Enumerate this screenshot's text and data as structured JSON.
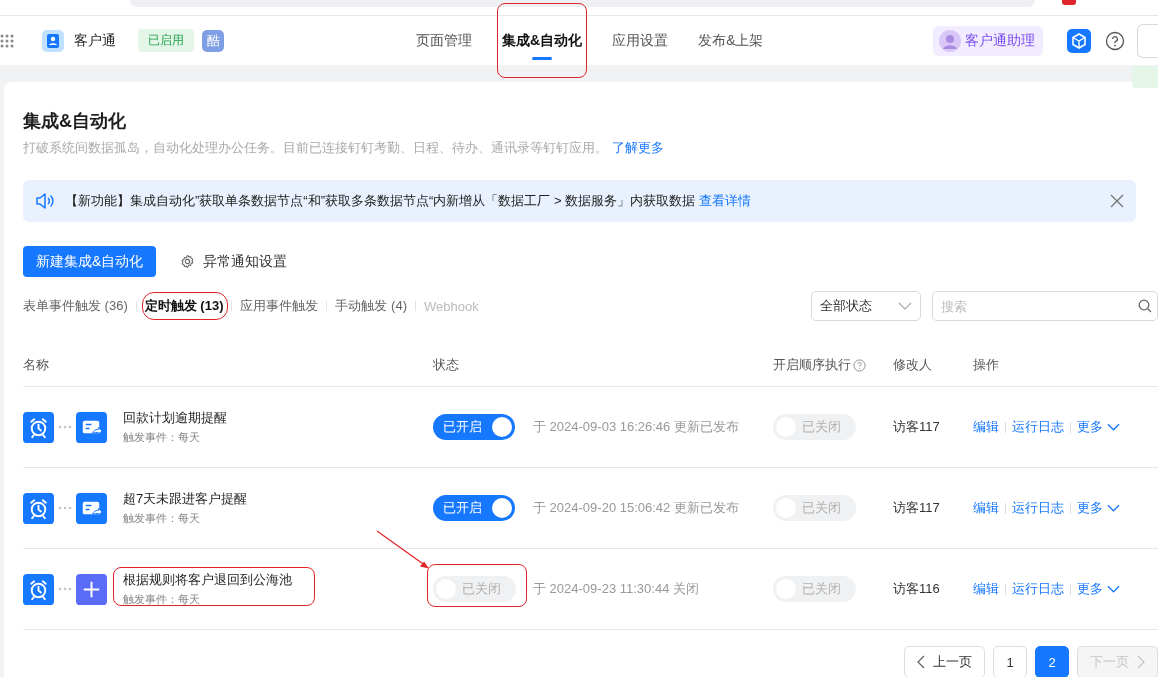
{
  "app": {
    "name": "客户通",
    "status_badge": "已启用",
    "avatar_char": "酷"
  },
  "nav_tabs": [
    {
      "label": "页面管理",
      "selected": false,
      "circled": false
    },
    {
      "label": "集成&自动化",
      "selected": true,
      "circled": true
    },
    {
      "label": "应用设置",
      "selected": false,
      "circled": false
    },
    {
      "label": "发布&上架",
      "selected": false,
      "circled": false
    }
  ],
  "assistant_button": "客户通助理",
  "page": {
    "title": "集成&自动化",
    "description": "打破系统间数据孤岛，自动化处理办公任务。目前已连接钉钉考勤、日程、待办、通讯录等钉钉应用。",
    "learn_more_link": "了解更多"
  },
  "notice": {
    "text": "【新功能】集成自动化”获取单条数据节点“和”获取多条数据节点“内新增从「数据工厂 > 数据服务」内获取数据",
    "link": "查看详情"
  },
  "create_button": "新建集成&自动化",
  "settings_link": "异常通知设置",
  "filter_tabs": [
    {
      "label": "表单事件触发 (36)",
      "selected": false,
      "disabled": false,
      "circled": false
    },
    {
      "label": "定时触发 (13)",
      "selected": true,
      "disabled": false,
      "circled": true
    },
    {
      "label": "应用事件触发",
      "selected": false,
      "disabled": false,
      "circled": false
    },
    {
      "label": "手动触发 (4)",
      "selected": false,
      "disabled": false,
      "circled": false
    },
    {
      "label": "Webhook",
      "selected": false,
      "disabled": true,
      "circled": false
    }
  ],
  "status_filter": "全部状态",
  "search": {
    "placeholder": "搜索"
  },
  "table": {
    "columns": [
      {
        "label": "名称",
        "help": false
      },
      {
        "label": "状态",
        "help": false
      },
      {
        "label": "开启顺序执行",
        "help": true
      },
      {
        "label": "修改人",
        "help": false
      },
      {
        "label": "操作",
        "help": false
      }
    ],
    "rows": [
      {
        "name": "回款计划逾期提醒",
        "trigger": "触发事件：每天",
        "action_icon": {
          "kind": "card"
        },
        "status": {
          "on": true,
          "label": "已开启"
        },
        "update_note": "于 2024-09-03 16:26:46 更新已发布",
        "sequential": {
          "on": false,
          "label": "已关闭"
        },
        "modifier": "访客117",
        "actions": [
          "编辑",
          "运行日志",
          "更多"
        ],
        "name_circled": false,
        "status_circled": false
      },
      {
        "name": "超7天未跟进客户提醒",
        "trigger": "触发事件：每天",
        "action_icon": {
          "kind": "card"
        },
        "status": {
          "on": true,
          "label": "已开启"
        },
        "update_note": "于 2024-09-20 15:06:42 更新已发布",
        "sequential": {
          "on": false,
          "label": "已关闭"
        },
        "modifier": "访客117",
        "actions": [
          "编辑",
          "运行日志",
          "更多"
        ],
        "name_circled": false,
        "status_circled": false
      },
      {
        "name": "根据规则将客户退回到公海池",
        "trigger": "触发事件：每天",
        "action_icon": {
          "kind": "add"
        },
        "status": {
          "on": false,
          "label": "已关闭"
        },
        "update_note": "于 2024-09-23 11:30:44 关闭",
        "sequential": {
          "on": false,
          "label": "已关闭"
        },
        "modifier": "访客116",
        "actions": [
          "编辑",
          "运行日志",
          "更多"
        ],
        "name_circled": true,
        "status_circled": true
      }
    ]
  },
  "pagination": {
    "prev": "上一页",
    "pages": [
      {
        "label": "1",
        "selected": false
      },
      {
        "label": "2",
        "selected": true
      }
    ],
    "next": "下一页",
    "next_disabled": true
  }
}
